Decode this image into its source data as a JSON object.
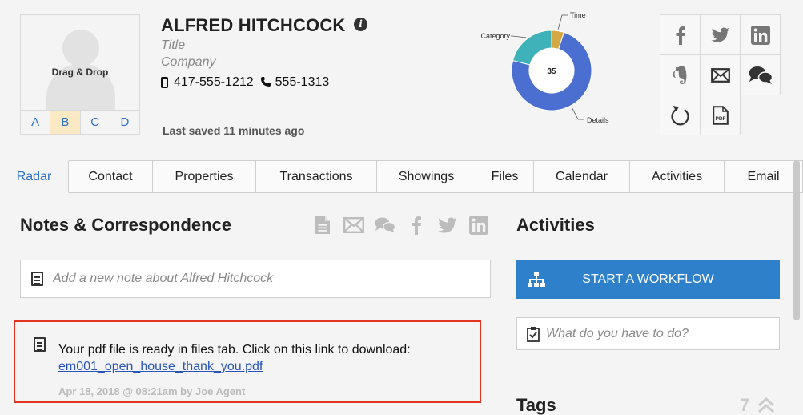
{
  "avatar": {
    "drop_text": "Drag & Drop",
    "grades": [
      "A",
      "B",
      "C",
      "D"
    ],
    "active_grade": "B"
  },
  "contact": {
    "name": "ALFRED HITCHCOCK",
    "title_placeholder": "Title",
    "company_placeholder": "Company",
    "mobile": "417-555-1212",
    "phone": "555-1313",
    "last_saved": "Last saved 11 minutes ago"
  },
  "chart_data": {
    "type": "pie",
    "variant": "donut",
    "center_label": "35",
    "slices": [
      {
        "name": "Time",
        "value": 5,
        "color": "#d4a843"
      },
      {
        "name": "Details",
        "value": 74,
        "color": "#4a6fd1"
      },
      {
        "name": "Category",
        "value": 21,
        "color": "#3fb1b8"
      }
    ]
  },
  "social": {
    "icons": [
      "facebook-icon",
      "twitter-icon",
      "linkedin-icon",
      "evernote-icon",
      "email-icon",
      "chat-icon",
      "refresh-icon",
      "pdf-icon"
    ],
    "pdf_label": "PDF"
  },
  "tabs": [
    {
      "label": "Radar",
      "active": true
    },
    {
      "label": "Contact"
    },
    {
      "label": "Properties"
    },
    {
      "label": "Transactions"
    },
    {
      "label": "Showings"
    },
    {
      "label": "Files"
    },
    {
      "label": "Calendar"
    },
    {
      "label": "Activities"
    },
    {
      "label": "Email"
    }
  ],
  "notes": {
    "title": "Notes & Correspondence",
    "input_placeholder": "Add a new note about Alfred Hitchcock",
    "items": [
      {
        "text": "Your pdf file is ready in files tab. Click on this link to download:",
        "link": "em001_open_house_thank_you.pdf",
        "meta": "Apr 18, 2018 @ 08:21am by Joe Agent"
      }
    ]
  },
  "activities": {
    "title": "Activities",
    "workflow_label": "START A WORKFLOW",
    "todo_placeholder": "What do you have to do?"
  },
  "tags": {
    "title": "Tags",
    "count": "7"
  },
  "colors": {
    "accent": "#2d80c9",
    "highlight_border": "#e4341f",
    "active_grade_bg": "#fbe9c4"
  }
}
